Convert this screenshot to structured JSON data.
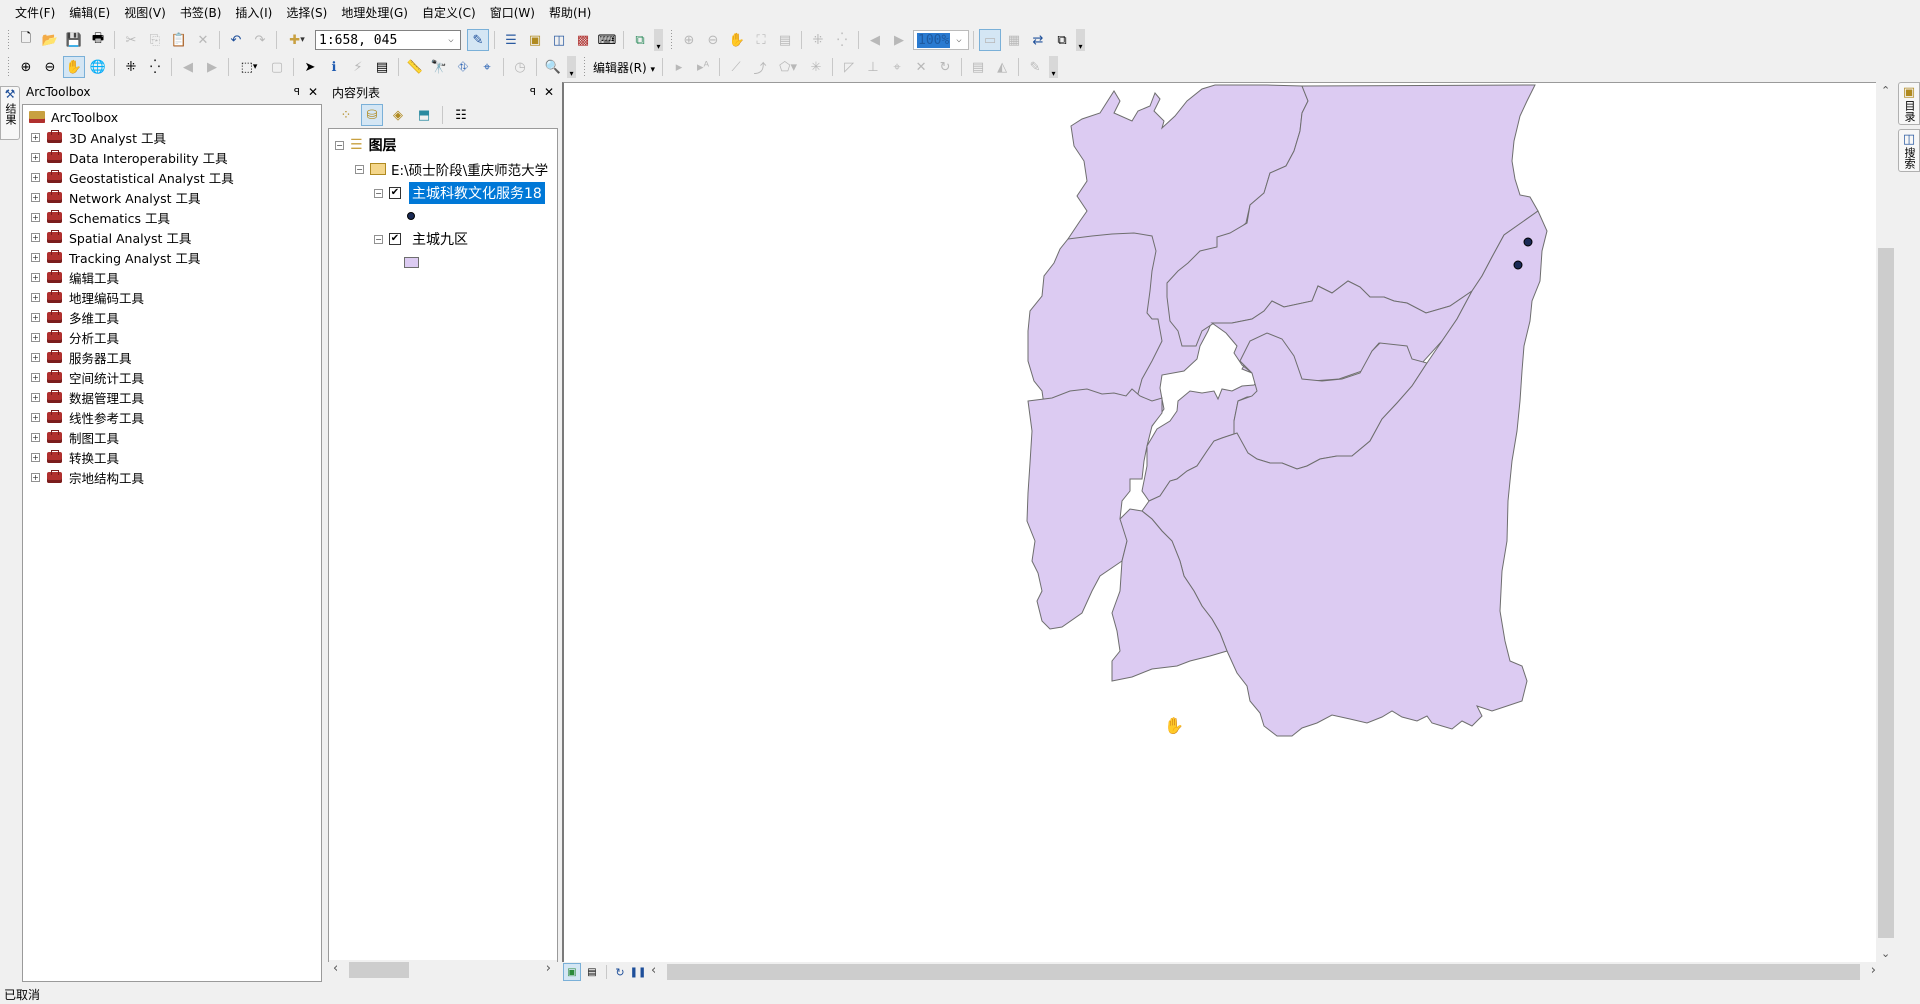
{
  "menu": [
    "文件(F)",
    "编辑(E)",
    "视图(V)",
    "书签(B)",
    "插入(I)",
    "选择(S)",
    "地理处理(G)",
    "自定义(C)",
    "窗口(W)",
    "帮助(H)"
  ],
  "toolbar": {
    "scale_value": "1:658, 045",
    "layout_zoom_value": "100%",
    "editor_label": "编辑器(R)"
  },
  "icons": {
    "new": "🗋",
    "open": "📂",
    "save": "💾",
    "print": "🖶",
    "cut": "✂",
    "copy": "⎘",
    "paste": "📋",
    "delete": "✕",
    "undo": "↶",
    "redo": "↷",
    "add_data": "✚",
    "zoom_in": "⊕",
    "zoom_out": "⊖",
    "pan": "✋",
    "full_extent": "🌐",
    "fixed_zoom_in": "⁜",
    "fixed_zoom_out": "⁛",
    "back": "◀",
    "forward": "▶",
    "select_features": "⬚",
    "clear_selection": "▢",
    "select_elements": "➤",
    "identify": "ℹ",
    "hyperlink": "⚡",
    "html_popup": "▤",
    "measure": "📏",
    "find": "🔭",
    "route": "⛗",
    "goto_xy": "⌖",
    "time_slider": "◷",
    "viewer": "🔍",
    "dropdown": "▾",
    "overflow": "▾"
  },
  "left_dock_tab": "结果",
  "right_dock_tabs": [
    "目录",
    "搜索"
  ],
  "toolbox_panel": {
    "title": "ArcToolbox",
    "pin": "📌",
    "close": "✕",
    "root": "ArcToolbox",
    "items": [
      "3D Analyst 工具",
      "Data Interoperability 工具",
      "Geostatistical Analyst 工具",
      "Network Analyst 工具",
      "Schematics 工具",
      "Spatial Analyst 工具",
      "Tracking Analyst 工具",
      "编辑工具",
      "地理编码工具",
      "多维工具",
      "分析工具",
      "服务器工具",
      "空间统计工具",
      "数据管理工具",
      "线性参考工具",
      "制图工具",
      "转换工具",
      "宗地结构工具"
    ]
  },
  "toc_panel": {
    "title": "内容列表",
    "pin": "📌",
    "close": "✕",
    "root": "图层",
    "folder": "E:\\硕士阶段\\重庆师范大学",
    "layers": [
      {
        "name": "主城科教文化服务18",
        "checked": true,
        "selected": true,
        "symbol": "point",
        "symbol_color": "#1a2a55"
      },
      {
        "name": "主城九区",
        "checked": true,
        "selected": false,
        "symbol": "polygon",
        "symbol_color": "#dccbf2"
      }
    ]
  },
  "map": {
    "fill_color": "#dccbf2",
    "outline_color": "#6e6e6e",
    "point_color": "#1a2a55"
  },
  "status": {
    "text": "已取消"
  }
}
